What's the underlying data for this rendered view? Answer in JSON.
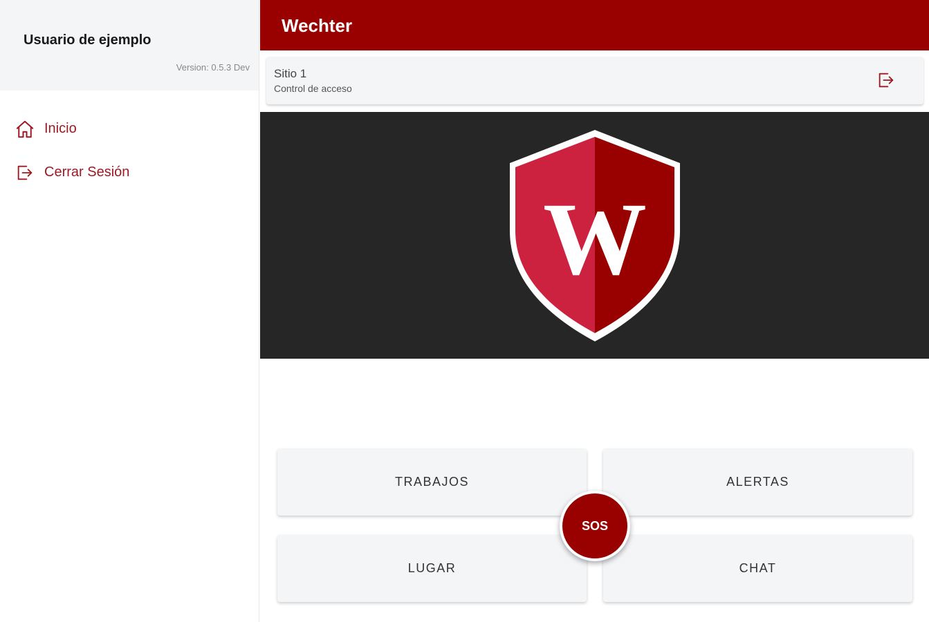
{
  "sidebar": {
    "user_name": "Usuario de ejemplo",
    "version": "Version: 0.5.3 Dev",
    "items": [
      {
        "label": "Inicio",
        "icon": "home-icon"
      },
      {
        "label": "Cerrar Sesión",
        "icon": "logout-icon"
      }
    ]
  },
  "header": {
    "title": "Wechter"
  },
  "site": {
    "name": "Sitio 1",
    "subtitle": "Control de acceso",
    "exit_icon": "logout-icon"
  },
  "banner": {
    "logo_letter": "W"
  },
  "actions": {
    "trabajos": "TRABAJOS",
    "alertas": "ALERTAS",
    "lugar": "LUGAR",
    "chat": "CHAT",
    "sos": "SOS"
  },
  "colors": {
    "brand": "#990000",
    "accent_text": "#9b1b24",
    "shield_light": "#cc2240",
    "banner_bg": "#262626",
    "surface": "#f4f5f7"
  }
}
